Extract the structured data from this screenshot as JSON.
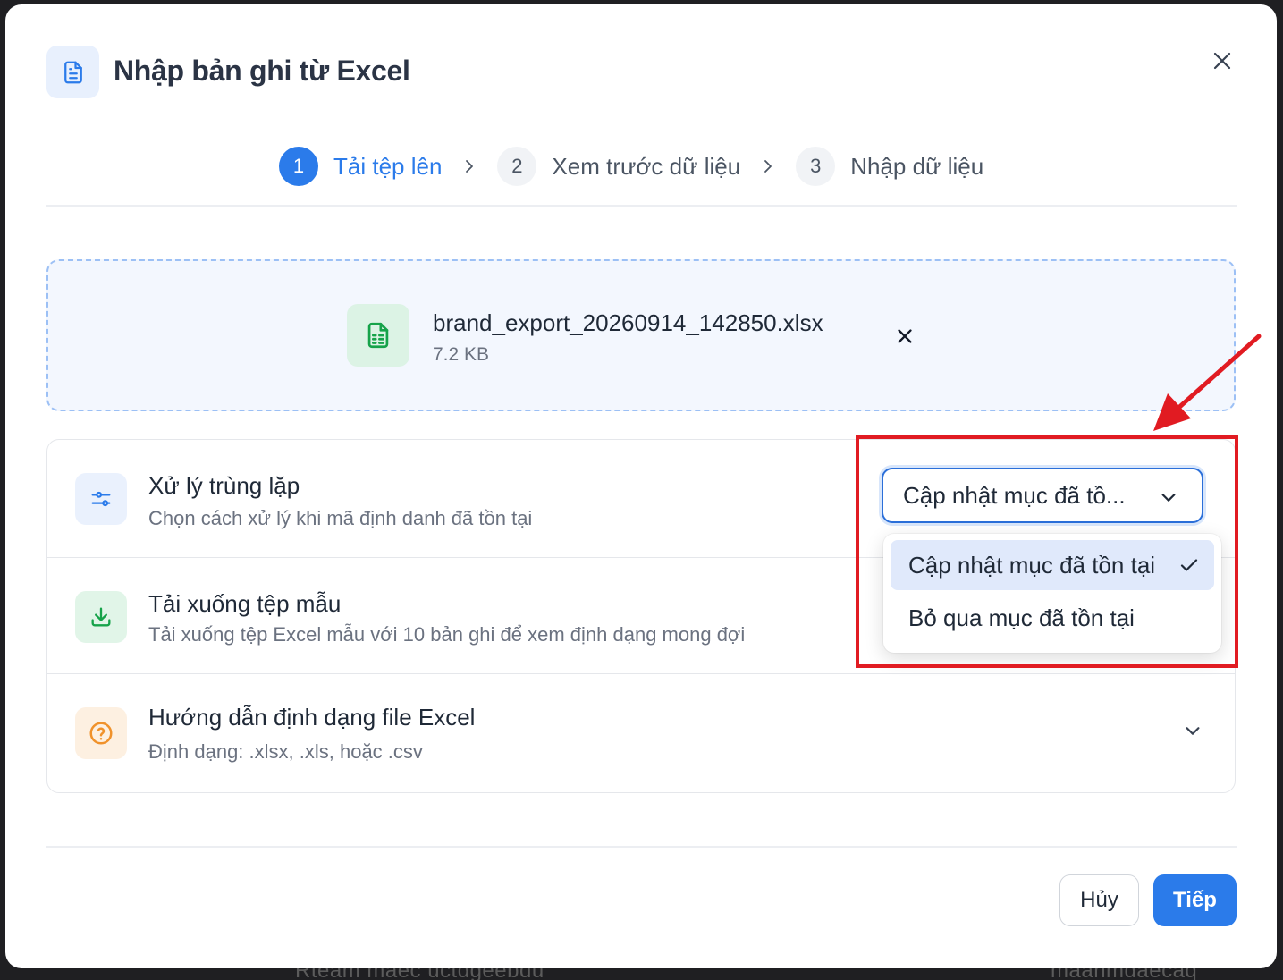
{
  "backdrop": {
    "left_text": "Rteam maec uctdgeebdu",
    "right_text": "maanmdaecaq"
  },
  "dialog": {
    "title": "Nhập bản ghi từ Excel",
    "header_icon": "document-icon",
    "close_icon": "close-icon"
  },
  "steps": [
    {
      "number": "1",
      "label": "Tải tệp lên",
      "active": true
    },
    {
      "number": "2",
      "label": "Xem trước dữ liệu",
      "active": false
    },
    {
      "number": "3",
      "label": "Nhập dữ liệu",
      "active": false
    }
  ],
  "upload": {
    "file_name": "brand_export_20260914_142850.xlsx",
    "file_size": "7.2 KB",
    "file_icon": "spreadsheet-icon"
  },
  "options": {
    "duplicate": {
      "title": "Xử lý trùng lặp",
      "description": "Chọn cách xử lý khi mã định danh đã tồn tại",
      "icon": "sliders-icon",
      "selected_value": "Cập nhật mục đã tồ...",
      "menu": [
        {
          "label": "Cập nhật mục đã tồn tại",
          "selected": true
        },
        {
          "label": "Bỏ qua mục đã tồn tại",
          "selected": false
        }
      ]
    },
    "template": {
      "title": "Tải xuống tệp mẫu",
      "description": "Tải xuống tệp Excel mẫu với 10 bản ghi để xem định dạng mong đợi",
      "icon": "download-icon"
    },
    "guide": {
      "title": "Hướng dẫn định dạng file Excel",
      "description": "Định dạng: .xlsx, .xls, hoặc .csv",
      "icon": "help-circle-icon"
    }
  },
  "footer": {
    "cancel_label": "Hủy",
    "next_label": "Tiếp"
  },
  "colors": {
    "primary": "#2b7bea",
    "annotation": "#e11b22",
    "success_bg": "#dcf3e5",
    "warning": "#f0922b"
  }
}
